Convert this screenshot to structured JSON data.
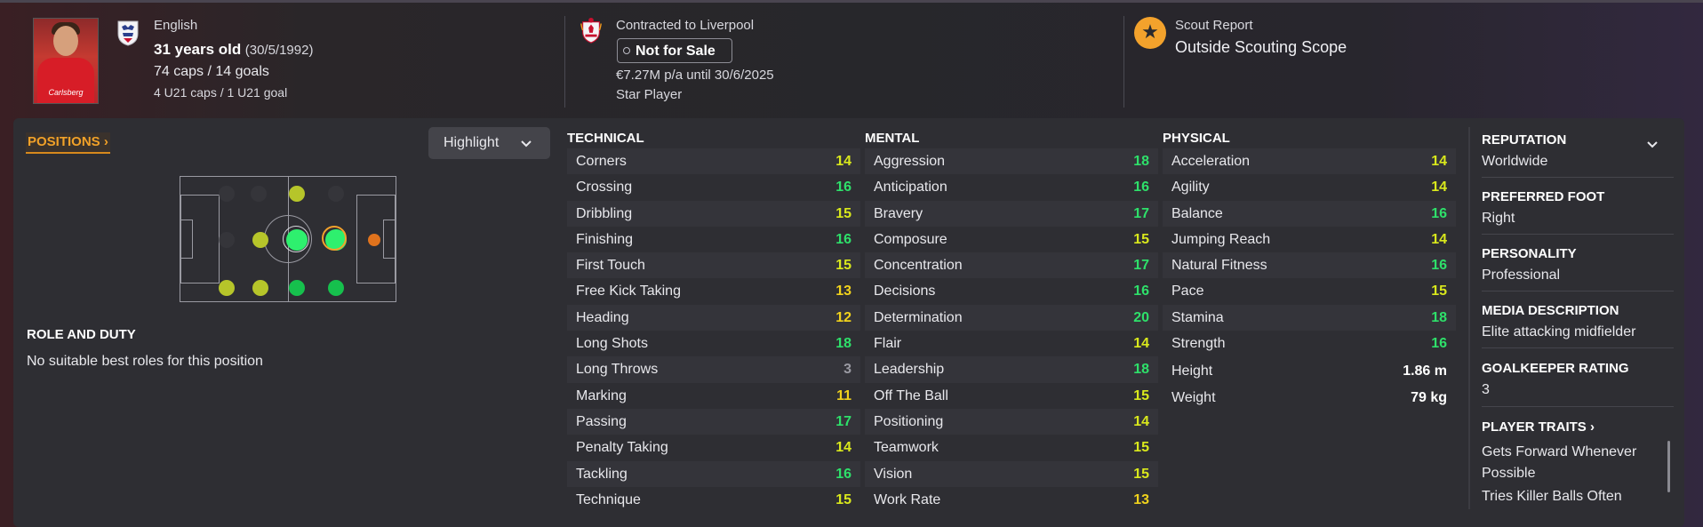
{
  "header": {
    "nationality": "English",
    "age": "31 years old",
    "dob": "(30/5/1992)",
    "caps": "74 caps / 14 goals",
    "u21": "4 U21 caps / 1 U21 goal",
    "photo_sponsor": "Carlsberg",
    "contract_title": "Contracted to Liverpool",
    "transfer_status": "Not for Sale",
    "wage": "€7.27M p/a until 30/6/2025",
    "squad_status": "Star Player",
    "scout_title": "Scout Report",
    "scout_value": "Outside Scouting Scope",
    "scout_icon": "star-icon"
  },
  "positions": {
    "tab_label": "POSITIONS",
    "highlight_label": "Highlight",
    "role_title": "ROLE AND DUTY",
    "role_text": "No suitable best roles for this position",
    "colors": {
      "natural": "#2ef06e",
      "accomplished": "#16c04d",
      "competent": "#b6c52a",
      "awkward": "#e0731d",
      "unfit": "#3a3a40"
    }
  },
  "technical": {
    "title": "TECHNICAL",
    "rows": [
      {
        "name": "Corners",
        "value": "14"
      },
      {
        "name": "Crossing",
        "value": "16"
      },
      {
        "name": "Dribbling",
        "value": "15"
      },
      {
        "name": "Finishing",
        "value": "16"
      },
      {
        "name": "First Touch",
        "value": "15"
      },
      {
        "name": "Free Kick Taking",
        "value": "13"
      },
      {
        "name": "Heading",
        "value": "12"
      },
      {
        "name": "Long Shots",
        "value": "18"
      },
      {
        "name": "Long Throws",
        "value": "3"
      },
      {
        "name": "Marking",
        "value": "11"
      },
      {
        "name": "Passing",
        "value": "17"
      },
      {
        "name": "Penalty Taking",
        "value": "14"
      },
      {
        "name": "Tackling",
        "value": "16"
      },
      {
        "name": "Technique",
        "value": "15"
      }
    ]
  },
  "mental": {
    "title": "MENTAL",
    "rows": [
      {
        "name": "Aggression",
        "value": "18"
      },
      {
        "name": "Anticipation",
        "value": "16"
      },
      {
        "name": "Bravery",
        "value": "17"
      },
      {
        "name": "Composure",
        "value": "15"
      },
      {
        "name": "Concentration",
        "value": "17"
      },
      {
        "name": "Decisions",
        "value": "16"
      },
      {
        "name": "Determination",
        "value": "20"
      },
      {
        "name": "Flair",
        "value": "14"
      },
      {
        "name": "Leadership",
        "value": "18"
      },
      {
        "name": "Off The Ball",
        "value": "15"
      },
      {
        "name": "Positioning",
        "value": "14"
      },
      {
        "name": "Teamwork",
        "value": "15"
      },
      {
        "name": "Vision",
        "value": "15"
      },
      {
        "name": "Work Rate",
        "value": "13"
      }
    ]
  },
  "physical": {
    "title": "PHYSICAL",
    "rows": [
      {
        "name": "Acceleration",
        "value": "14"
      },
      {
        "name": "Agility",
        "value": "14"
      },
      {
        "name": "Balance",
        "value": "16"
      },
      {
        "name": "Jumping Reach",
        "value": "14"
      },
      {
        "name": "Natural Fitness",
        "value": "16"
      },
      {
        "name": "Pace",
        "value": "15"
      },
      {
        "name": "Stamina",
        "value": "18"
      },
      {
        "name": "Strength",
        "value": "16"
      }
    ],
    "height_label": "Height",
    "height_value": "1.86 m",
    "weight_label": "Weight",
    "weight_value": "79 kg"
  },
  "value_colors": {
    "low": "#9a9aa2",
    "mid": "#f0d21c",
    "good": "#d9e81c",
    "high": "#2ee06a"
  },
  "side": {
    "reputation_title": "REPUTATION",
    "reputation_value": "Worldwide",
    "foot_title": "PREFERRED FOOT",
    "foot_value": "Right",
    "personality_title": "PERSONALITY",
    "personality_value": "Professional",
    "media_title": "MEDIA DESCRIPTION",
    "media_value": "Elite attacking midfielder",
    "gk_title": "GOALKEEPER RATING",
    "gk_value": "3",
    "traits_title": "PLAYER TRAITS",
    "traits": [
      "Gets Forward Whenever Possible",
      "Tries Killer Balls Often"
    ]
  }
}
